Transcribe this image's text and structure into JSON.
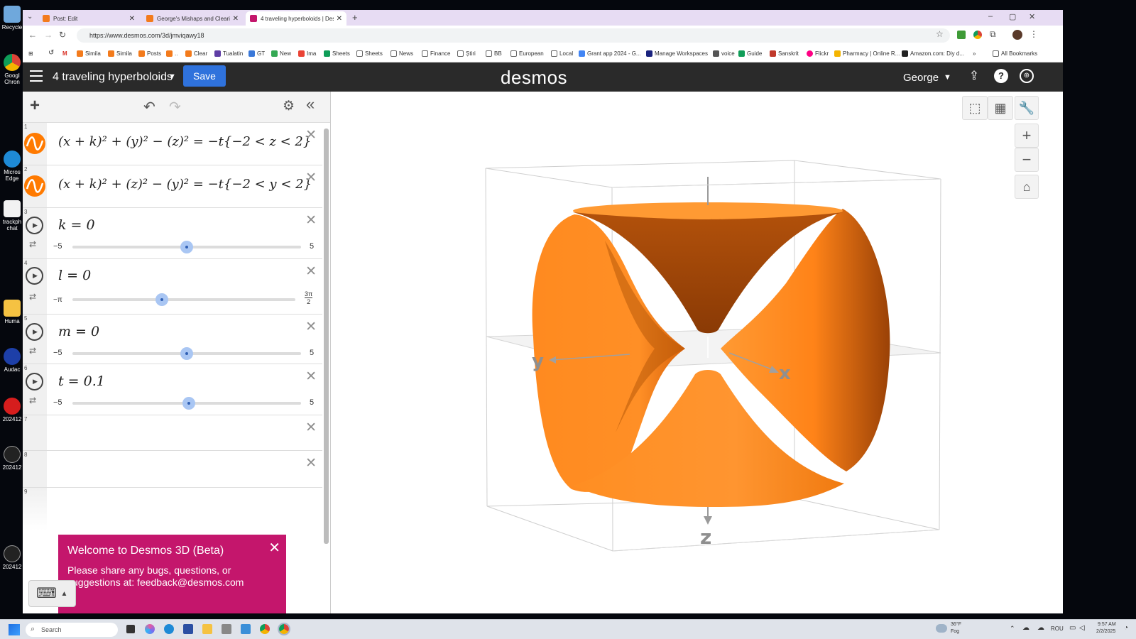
{
  "desktop": {
    "icons": [
      "Recycle",
      "Googl Chron",
      "Micros Edge",
      "trackph chat",
      "Huma",
      "Audac",
      "202412",
      "202412",
      "202412"
    ]
  },
  "browser": {
    "tabs": [
      {
        "title": "Post: Edit",
        "active": false
      },
      {
        "title": "George's Mishaps and Clearing",
        "active": false
      },
      {
        "title": "4 traveling hyperboloids | Desm",
        "active": true
      }
    ],
    "url": "https://www.desmos.com/3d/jmviqawy18",
    "bookmarks": [
      "Simila",
      "Simila",
      "Posts",
      "..",
      "Clear",
      "Tualatin",
      "GT",
      "New",
      "Ima",
      "Sheets",
      "Sheets",
      "News",
      "Finance",
      "Știri",
      "BB",
      "European",
      "Local",
      "Grant app 2024 - G...",
      "Manage Workspaces",
      "voice",
      "Guide",
      "Sanskrit",
      "Flickr",
      "Pharmacy | Online R...",
      "Amazon.com: Diy d...",
      "»",
      "All Bookmarks"
    ]
  },
  "header": {
    "title": "4 traveling hyperboloids",
    "save_label": "Save",
    "logo": "desmos",
    "user": "George"
  },
  "expressions": [
    {
      "num": "1",
      "latex_text": "(x + k)² + (y)² − (z)² = −t{−2 < z < 2}"
    },
    {
      "num": "2",
      "latex_text": "(x + k)² + (z)² − (y)² = −t{−2 < y < 2}"
    },
    {
      "num": "3",
      "formula": "k = 0",
      "min": "−5",
      "max": "5",
      "value": 0,
      "range": [
        -5,
        5
      ]
    },
    {
      "num": "4",
      "formula": "l = 0",
      "min": "−π",
      "max_num": "3π",
      "max_den": "2",
      "value": 0,
      "range": [
        -3.1416,
        4.7124
      ]
    },
    {
      "num": "5",
      "formula": "m = 0",
      "min": "−5",
      "max": "5",
      "value": 0,
      "range": [
        -5,
        5
      ]
    },
    {
      "num": "6",
      "formula": "t = 0.1",
      "min": "−5",
      "max": "5",
      "value": 0.1,
      "range": [
        -5,
        5
      ]
    },
    {
      "num": "7"
    },
    {
      "num": "8"
    },
    {
      "num": "9"
    }
  ],
  "welcome": {
    "title": "Welcome to Desmos 3D (Beta)",
    "body": "Please share any bugs, questions, or suggestions at: feedback@desmos.com"
  },
  "graph": {
    "axis_labels": {
      "x": "x",
      "y": "y",
      "z": "z"
    },
    "surface_color": "#ff8a1f"
  },
  "taskbar": {
    "search_placeholder": "Search",
    "weather_temp": "36°F",
    "weather_desc": "Fog",
    "lang": "ROU",
    "time": "9:57 AM",
    "date": "2/2/2025"
  }
}
